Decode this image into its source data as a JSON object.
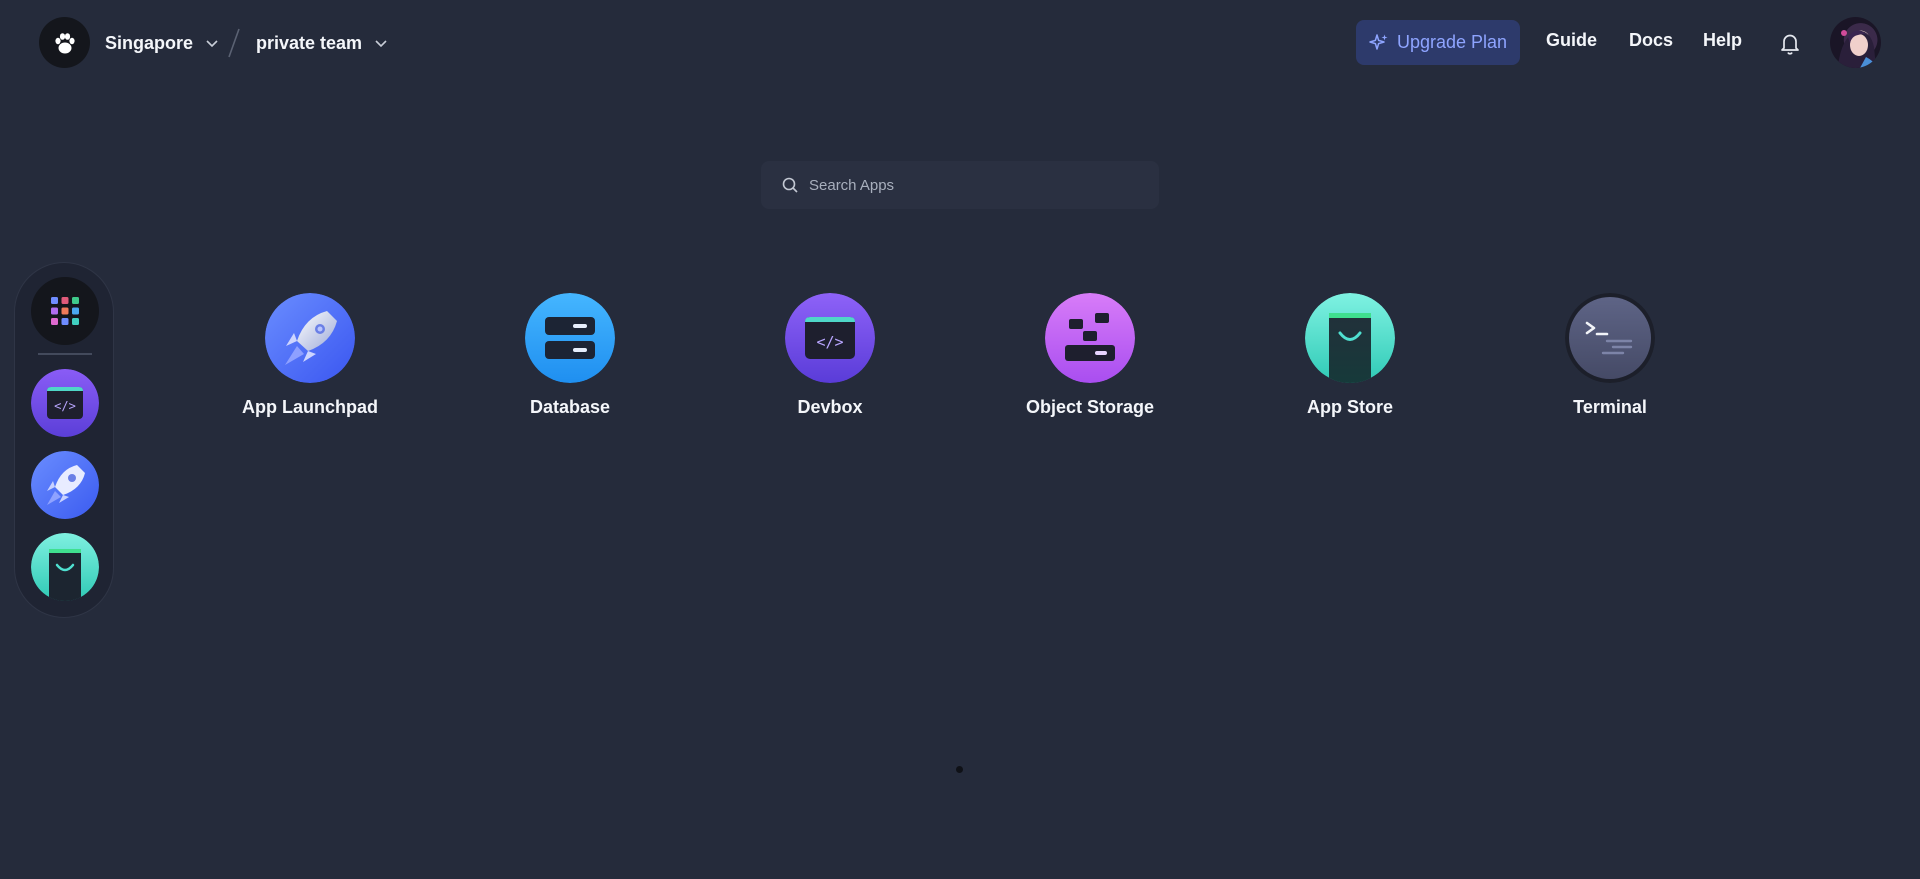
{
  "header": {
    "region": "Singapore",
    "team": "private team",
    "upgrade_label": "Upgrade Plan",
    "nav": {
      "guide": "Guide",
      "docs": "Docs",
      "help": "Help"
    }
  },
  "search": {
    "placeholder": "Search Apps",
    "value": ""
  },
  "apps": [
    {
      "label": "App Launchpad",
      "icon": "rocket-icon"
    },
    {
      "label": "Database",
      "icon": "database-icon"
    },
    {
      "label": "Devbox",
      "icon": "code-box-icon"
    },
    {
      "label": "Object Storage",
      "icon": "storage-icon"
    },
    {
      "label": "App Store",
      "icon": "shopping-bag-icon"
    },
    {
      "label": "Terminal",
      "icon": "terminal-icon"
    }
  ],
  "dock": {
    "items": [
      "grid-icon",
      "code-box-icon",
      "rocket-icon",
      "shopping-bag-icon"
    ]
  },
  "pagination": {
    "pages": 1,
    "current": 1
  },
  "colors": {
    "background": "#252b3b",
    "accent": "#8ea4ff",
    "upgrade_bg": "#2d3a6b"
  }
}
